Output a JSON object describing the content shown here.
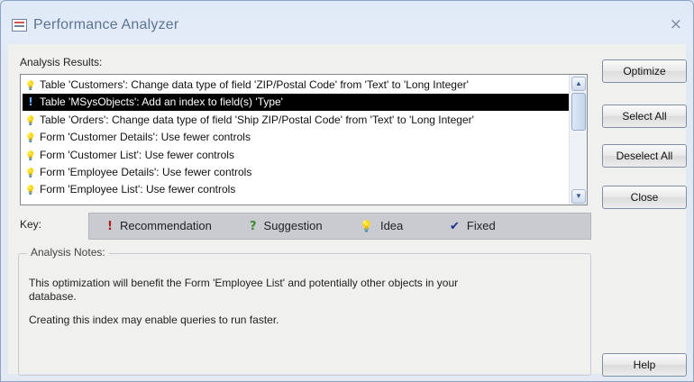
{
  "window": {
    "title": "Performance Analyzer",
    "close_glyph": "×"
  },
  "results": {
    "label": "Analysis Results:",
    "items": [
      {
        "icon": "idea-icon",
        "glyph": "💡",
        "text": "Table 'Customers': Change data type of field 'ZIP/Postal Code' from 'Text' to 'Long Integer'",
        "selected": false
      },
      {
        "icon": "recommendation-icon",
        "glyph": "!",
        "text": "Table 'MSysObjects': Add an index to field(s) 'Type'",
        "selected": true
      },
      {
        "icon": "idea-icon",
        "glyph": "💡",
        "text": "Table 'Orders': Change data type of field 'Ship ZIP/Postal Code' from 'Text' to 'Long Integer'",
        "selected": false
      },
      {
        "icon": "idea-icon",
        "glyph": "💡",
        "text": "Form 'Customer Details': Use fewer controls",
        "selected": false
      },
      {
        "icon": "idea-icon",
        "glyph": "💡",
        "text": "Form 'Customer List': Use fewer controls",
        "selected": false
      },
      {
        "icon": "idea-icon",
        "glyph": "💡",
        "text": "Form 'Employee Details': Use fewer controls",
        "selected": false
      },
      {
        "icon": "idea-icon",
        "glyph": "💡",
        "text": "Form 'Employee List': Use fewer controls",
        "selected": false
      }
    ]
  },
  "key": {
    "label": "Key:",
    "items": [
      {
        "name": "recommendation",
        "glyph": "!",
        "color": "#b01c1c",
        "label": "Recommendation"
      },
      {
        "name": "suggestion",
        "glyph": "?",
        "color": "#3c8c2c",
        "label": "Suggestion"
      },
      {
        "name": "idea",
        "glyph": "💡",
        "color": "#b49416",
        "label": "Idea"
      },
      {
        "name": "fixed",
        "glyph": "✔",
        "color": "#1c2f8c",
        "label": "Fixed"
      }
    ]
  },
  "notes": {
    "label": "Analysis Notes:",
    "line1": "This optimization will benefit the Form 'Employee List' and potentially other objects in your",
    "line2": "database.",
    "line3": "Creating this index may enable queries to run faster."
  },
  "buttons": {
    "optimize": "Optimize",
    "select_all": "Select All",
    "deselect_all": "Deselect All",
    "close": "Close",
    "help": "Help"
  },
  "colors": {
    "selection": "#000000",
    "title_text": "#5d7394"
  }
}
